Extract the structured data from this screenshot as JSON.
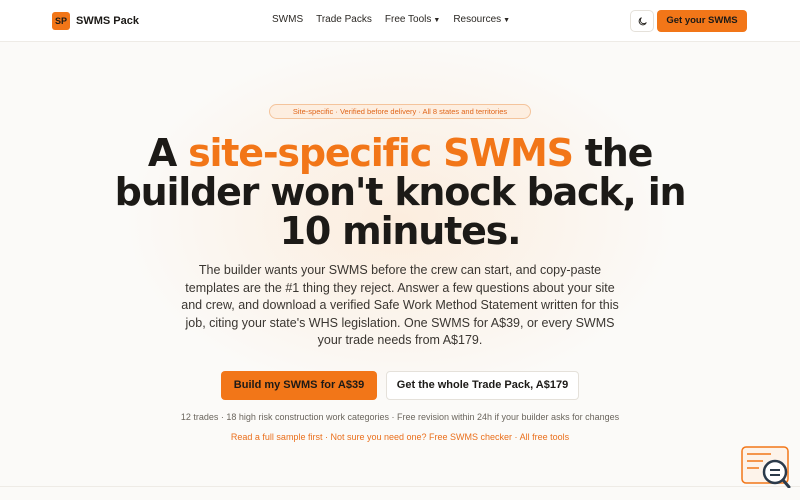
{
  "header": {
    "logo_mark": "SP",
    "brand": "SWMS Pack",
    "nav": [
      {
        "label": "SWMS",
        "dropdown": false
      },
      {
        "label": "Trade Packs",
        "dropdown": false
      },
      {
        "label": "Free Tools",
        "dropdown": true
      },
      {
        "label": "Resources",
        "dropdown": true
      }
    ],
    "theme_icon": "moon-icon",
    "cta_label": "Get your SWMS"
  },
  "hero": {
    "badge": "Site-specific · Verified before delivery · All 8 states and territories",
    "title_part1": "A ",
    "title_accent": "site-specific SWMS",
    "title_part2": " the builder won't knock back, in 10 minutes.",
    "lead": "The builder wants your SWMS before the crew can start, and copy-paste templates are the #1 thing they reject. Answer a few questions about your site and crew, and download a verified Safe Work Method Statement written for this job, citing your state's WHS legislation. One SWMS for A$39, or every SWMS your trade needs from A$179.",
    "primary_button": "Build my SWMS for A$39",
    "secondary_button": "Get the whole Trade Pack, A$179",
    "meta": "12 trades · 18 high risk construction work categories · Free revision within 24h if your builder asks for changes",
    "links": [
      {
        "label": "Read a full sample first"
      },
      {
        "label": "Not sure you need one? Free SWMS checker"
      },
      {
        "label": "All free tools"
      }
    ],
    "link_separator": " · "
  },
  "colors": {
    "accent": "#f27618",
    "badge_bg": "#fdeee0",
    "text": "#1c1a17"
  },
  "widget": {
    "icon": "search-chat-icon"
  }
}
